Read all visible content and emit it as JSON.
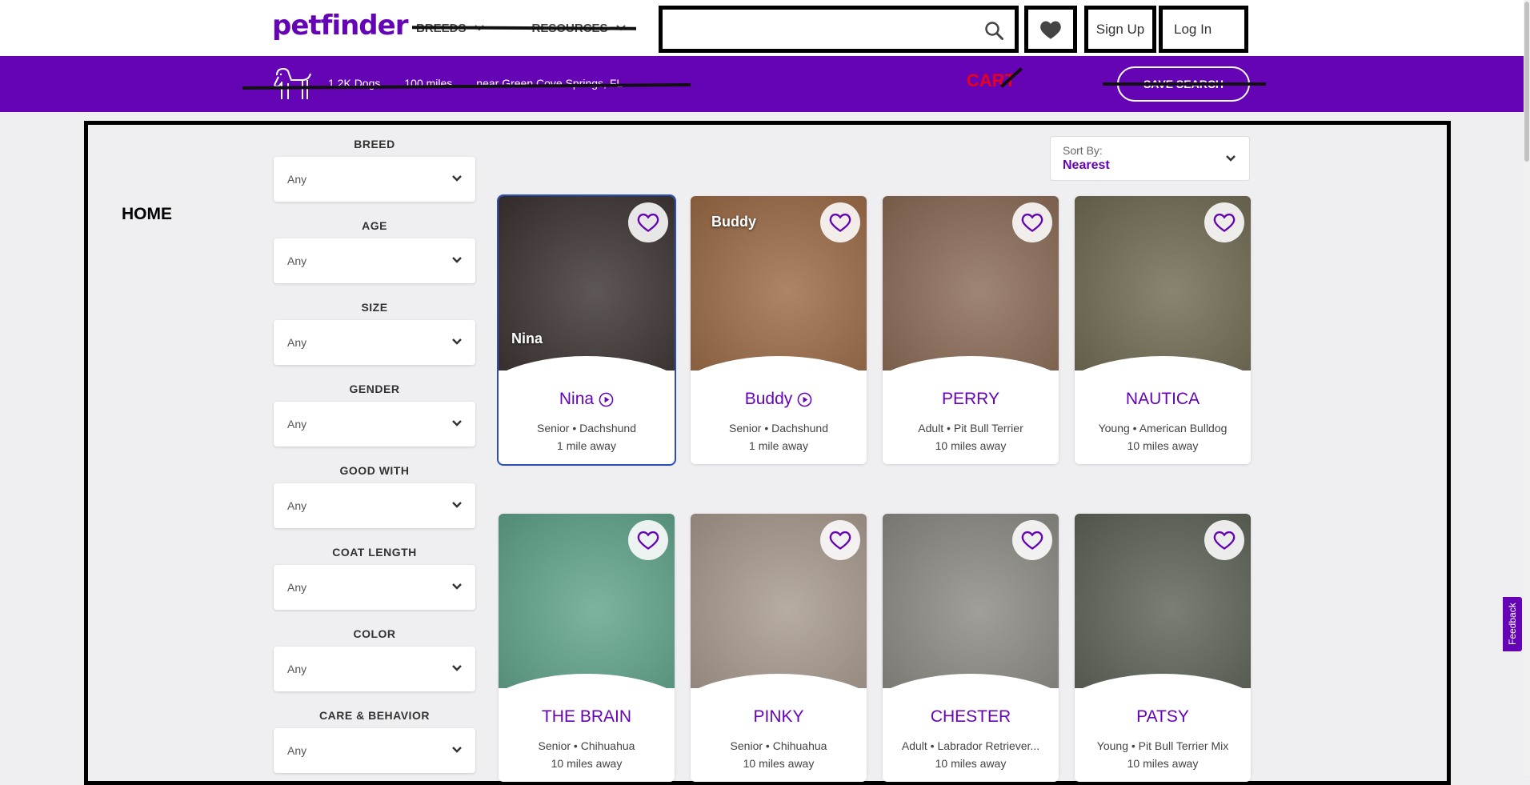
{
  "header": {
    "logo": "petfinder",
    "nav": [
      {
        "label": "BREEDS"
      },
      {
        "label": "RESOURCES"
      }
    ],
    "search_placeholder": "",
    "signup_label": "Sign Up",
    "login_label": "Log In"
  },
  "searchbar": {
    "count": "1.2K Dogs",
    "distance": "100 miles",
    "location": "near Green Cove Springs, FL",
    "cart_annotation": "CART",
    "save_search_label": "SAVE SEARCH"
  },
  "annotation": {
    "home": "HOME"
  },
  "filters": [
    {
      "label": "BREED",
      "value": "Any"
    },
    {
      "label": "AGE",
      "value": "Any"
    },
    {
      "label": "SIZE",
      "value": "Any"
    },
    {
      "label": "GENDER",
      "value": "Any"
    },
    {
      "label": "GOOD WITH",
      "value": "Any"
    },
    {
      "label": "COAT LENGTH",
      "value": "Any"
    },
    {
      "label": "COLOR",
      "value": "Any"
    },
    {
      "label": "CARE & BEHAVIOR",
      "value": "Any"
    }
  ],
  "sort": {
    "label": "Sort By:",
    "value": "Nearest"
  },
  "pets": [
    {
      "name": "Nina",
      "age": "Senior",
      "breed": "Dachshund",
      "distance": "1 mile away",
      "has_video": true,
      "photo_tag": "Nina",
      "photo_color": "#3a3230"
    },
    {
      "name": "Buddy",
      "age": "Senior",
      "breed": "Dachshund",
      "distance": "1 mile away",
      "has_video": true,
      "photo_tag": "Buddy",
      "photo_color": "#9b6a45"
    },
    {
      "name": "PERRY",
      "age": "Adult",
      "breed": "Pit Bull Terrier",
      "distance": "10 miles away",
      "has_video": false,
      "photo_tag": "",
      "photo_color": "#8a6a55"
    },
    {
      "name": "NAUTICA",
      "age": "Young",
      "breed": "American Bulldog",
      "distance": "10 miles away",
      "has_video": false,
      "photo_tag": "",
      "photo_color": "#6f6a52"
    },
    {
      "name": "THE BRAIN",
      "age": "Senior",
      "breed": "Chihuahua",
      "distance": "10 miles away",
      "has_video": false,
      "photo_tag": "",
      "photo_color": "#5fa38a"
    },
    {
      "name": "PINKY",
      "age": "Senior",
      "breed": "Chihuahua",
      "distance": "10 miles away",
      "has_video": false,
      "photo_tag": "",
      "photo_color": "#a89a8e"
    },
    {
      "name": "CHESTER",
      "age": "Adult",
      "breed": "Labrador Retriever...",
      "distance": "10 miles away",
      "has_video": false,
      "photo_tag": "",
      "photo_color": "#8b8a83"
    },
    {
      "name": "PATSY",
      "age": "Young",
      "breed": "Pit Bull Terrier Mix",
      "distance": "10 miles away",
      "has_video": false,
      "photo_tag": "",
      "photo_color": "#5d6358"
    }
  ],
  "feedback_label": "Feedback",
  "colors": {
    "brand_purple": "#6504b5",
    "annotation_red": "#e8001c"
  }
}
